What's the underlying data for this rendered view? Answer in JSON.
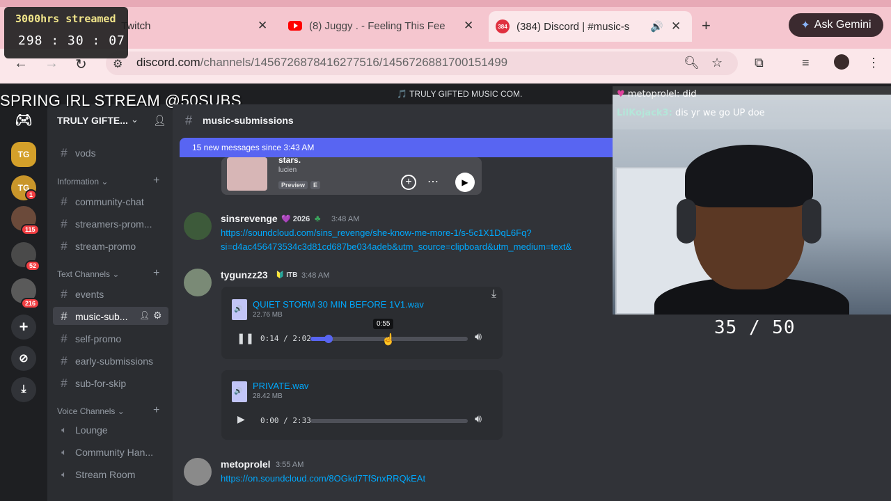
{
  "browser": {
    "tabs": [
      {
        "label": "Twitch",
        "active": false
      },
      {
        "label": "(8) Juggy . - Feeling This Fee",
        "active": false
      },
      {
        "label": "(384) Discord | #music-s",
        "active": true,
        "badge": "384"
      }
    ],
    "close_glyph": "✕",
    "new_tab_glyph": "+",
    "gemini_label": "Ask Gemini",
    "url_host": "discord.com",
    "url_path": "/channels/1456726878416277516/1456726881700151499"
  },
  "overlay": {
    "streamed": "3000hrs streamed",
    "timer": "298 : 30 : 07",
    "banner": "SPRING IRL STREAM @50SUBS",
    "sub_counter": "35 / 50"
  },
  "stream_chat": [
    {
      "user": "metoprolel:",
      "text": "did"
    },
    {
      "user": "LilKojack3:",
      "text": "dis yr we go UP doe"
    }
  ],
  "discord": {
    "top_title": "TRULY GIFTED MUSIC COM.",
    "server_name": "TRULY GIFTE...",
    "channel_header": "music-submissions",
    "new_messages": "15 new messages since 3:43 AM",
    "rail": [
      {
        "label": "TG",
        "badge": ""
      },
      {
        "label": "TG",
        "badge": "1"
      },
      {
        "label": "",
        "badge": "115"
      },
      {
        "label": "",
        "badge": "52"
      },
      {
        "label": "",
        "badge": "216"
      }
    ],
    "categories": {
      "information": "Information",
      "text": "Text Channels",
      "voice": "Voice Channels"
    },
    "channels": {
      "vods": "vods",
      "community_chat": "community-chat",
      "streamers_promo": "streamers-prom...",
      "stream_promo": "stream-promo",
      "events": "events",
      "music_sub": "music-sub...",
      "self_promo": "self-promo",
      "early_submissions": "early-submissions",
      "sub_for_skip": "sub-for-skip"
    },
    "voice_channels": {
      "lounge": "Lounge",
      "community": "Community Han...",
      "stream_room": "Stream Room"
    },
    "prev_embed": {
      "title": "stars.",
      "artist": "lucien",
      "preview": "Preview",
      "explicit": "E"
    },
    "messages": [
      {
        "user": "sinsrevenge",
        "tag": "2026",
        "time": "3:48 AM",
        "link1": "https://soundcloud.com/sins_revenge/she-know-me-more-1/s-5c1X1DqL6Fq?",
        "link2": "si=d4ac456473534c3d81cd687be034adeb&utm_source=clipboard&utm_medium=text&"
      },
      {
        "user": "tygunzz23",
        "tag": "ITB",
        "time": "3:48 AM",
        "files": [
          {
            "name": "QUIET STORM 30 MIN BEFORE 1V1.wav",
            "size": "22.76 MB",
            "time": "0:14 / 2:02",
            "progress": 0.115,
            "hover_time": "0:55",
            "playing": true
          },
          {
            "name": "PRIVATE.wav",
            "size": "28.42 MB",
            "time": "0:00 / 2:33",
            "progress": 0,
            "playing": false
          }
        ]
      },
      {
        "user": "metoprolel",
        "time": "3:55 AM",
        "link1": "https://on.soundcloud.com/8OGkd7TfSnxRRQkEAt"
      }
    ]
  },
  "colors": {
    "tab_bg": "#f5c6cf",
    "discord_blurple": "#5865f2",
    "link": "#00a8fc",
    "badge_red": "#f23f43"
  }
}
